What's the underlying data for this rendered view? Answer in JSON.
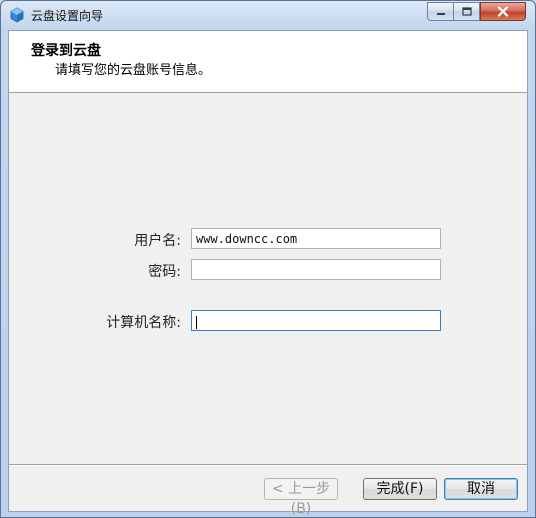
{
  "window": {
    "title": "云盘设置向导",
    "icon": "cloud-app-icon"
  },
  "header": {
    "title": "登录到云盘",
    "subtitle": "请填写您的云盘账号信息。"
  },
  "form": {
    "username_label": "用户名:",
    "username_value": "www.downcc.com",
    "password_label": "密码:",
    "password_value": "",
    "computer_label": "计算机名称:",
    "computer_value": ""
  },
  "buttons": {
    "back_label": "< 上一步(B)",
    "finish_label": "完成(F)",
    "cancel_label": "取消"
  },
  "colors": {
    "titlebar": "#c3d6ec",
    "client": "#f0f0f0",
    "close_button": "#c3422a"
  }
}
